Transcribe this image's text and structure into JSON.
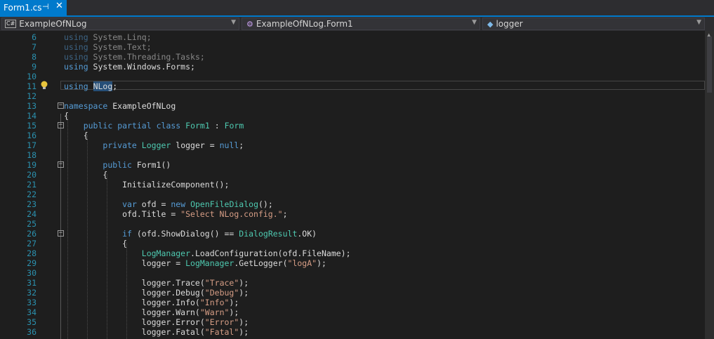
{
  "tab": {
    "title": "Form1.cs",
    "pin": "⊣",
    "close": "✕"
  },
  "nav": {
    "project": "ExampleOfNLog",
    "type": "ExampleOfNLog.Form1",
    "member": "logger",
    "project_icon": "csharp-file-icon",
    "type_icon": "class-icon",
    "member_icon": "field-icon"
  },
  "colors": {
    "accent": "#007acc",
    "keyword": "#569cd6",
    "type": "#4ec9b0",
    "string": "#d69d85",
    "line_number": "#2b91af"
  },
  "code_lines": [
    {
      "n": "6",
      "tokens": [
        [
          "kw dim",
          "using"
        ],
        [
          "dim",
          " System.Linq;"
        ]
      ]
    },
    {
      "n": "7",
      "tokens": [
        [
          "kw dim",
          "using"
        ],
        [
          "dim",
          " System.Text;"
        ]
      ]
    },
    {
      "n": "8",
      "tokens": [
        [
          "kw dim",
          "using"
        ],
        [
          "dim",
          " System.Threading.Tasks;"
        ]
      ]
    },
    {
      "n": "9",
      "tokens": [
        [
          "kw",
          "using"
        ],
        [
          "",
          " System.Windows.Forms;"
        ]
      ]
    },
    {
      "n": "10",
      "tokens": []
    },
    {
      "n": "11",
      "tokens": [
        [
          "kw",
          "using"
        ],
        [
          "",
          " "
        ],
        [
          "sel",
          "NLog"
        ],
        [
          "",
          ";"
        ]
      ]
    },
    {
      "n": "12",
      "tokens": []
    },
    {
      "n": "13",
      "tokens": [
        [
          "kw",
          "namespace"
        ],
        [
          "",
          " ExampleOfNLog"
        ]
      ]
    },
    {
      "n": "14",
      "tokens": [
        [
          "",
          "{"
        ]
      ]
    },
    {
      "n": "15",
      "tokens": [
        [
          "",
          "    "
        ],
        [
          "kw",
          "public"
        ],
        [
          "",
          " "
        ],
        [
          "kw",
          "partial"
        ],
        [
          "",
          " "
        ],
        [
          "kw",
          "class"
        ],
        [
          "",
          " "
        ],
        [
          "ty",
          "Form1"
        ],
        [
          "",
          " : "
        ],
        [
          "ty",
          "Form"
        ]
      ]
    },
    {
      "n": "16",
      "tokens": [
        [
          "",
          "    {"
        ]
      ]
    },
    {
      "n": "17",
      "tokens": [
        [
          "",
          "        "
        ],
        [
          "kw",
          "private"
        ],
        [
          "",
          " "
        ],
        [
          "ty",
          "Logger"
        ],
        [
          "",
          " logger = "
        ],
        [
          "kw",
          "null"
        ],
        [
          "",
          ";"
        ]
      ]
    },
    {
      "n": "18",
      "tokens": []
    },
    {
      "n": "19",
      "tokens": [
        [
          "",
          "        "
        ],
        [
          "kw",
          "public"
        ],
        [
          "",
          " Form1()"
        ]
      ]
    },
    {
      "n": "20",
      "tokens": [
        [
          "",
          "        {"
        ]
      ]
    },
    {
      "n": "21",
      "tokens": [
        [
          "",
          "            InitializeComponent();"
        ]
      ]
    },
    {
      "n": "22",
      "tokens": []
    },
    {
      "n": "23",
      "tokens": [
        [
          "",
          "            "
        ],
        [
          "kw",
          "var"
        ],
        [
          "",
          " ofd = "
        ],
        [
          "kw",
          "new"
        ],
        [
          "",
          " "
        ],
        [
          "ty",
          "OpenFileDialog"
        ],
        [
          "",
          "();"
        ]
      ]
    },
    {
      "n": "24",
      "tokens": [
        [
          "",
          "            ofd.Title = "
        ],
        [
          "str",
          "\"Select NLog.config.\""
        ],
        [
          "",
          ";"
        ]
      ]
    },
    {
      "n": "25",
      "tokens": []
    },
    {
      "n": "26",
      "tokens": [
        [
          "",
          "            "
        ],
        [
          "kw",
          "if"
        ],
        [
          "",
          " (ofd.ShowDialog() == "
        ],
        [
          "ty",
          "DialogResult"
        ],
        [
          "",
          ".OK)"
        ]
      ]
    },
    {
      "n": "27",
      "tokens": [
        [
          "",
          "            {"
        ]
      ]
    },
    {
      "n": "28",
      "tokens": [
        [
          "",
          "                "
        ],
        [
          "ty",
          "LogManager"
        ],
        [
          "",
          ".LoadConfiguration(ofd.FileName);"
        ]
      ]
    },
    {
      "n": "29",
      "tokens": [
        [
          "",
          "                logger = "
        ],
        [
          "ty",
          "LogManager"
        ],
        [
          "",
          ".GetLogger("
        ],
        [
          "str",
          "\"logA\""
        ],
        [
          "",
          ");"
        ]
      ]
    },
    {
      "n": "30",
      "tokens": []
    },
    {
      "n": "31",
      "tokens": [
        [
          "",
          "                logger.Trace("
        ],
        [
          "str",
          "\"Trace\""
        ],
        [
          "",
          ");"
        ]
      ]
    },
    {
      "n": "32",
      "tokens": [
        [
          "",
          "                logger.Debug("
        ],
        [
          "str",
          "\"Debug\""
        ],
        [
          "",
          ");"
        ]
      ]
    },
    {
      "n": "33",
      "tokens": [
        [
          "",
          "                logger.Info("
        ],
        [
          "str",
          "\"Info\""
        ],
        [
          "",
          ");"
        ]
      ]
    },
    {
      "n": "34",
      "tokens": [
        [
          "",
          "                logger.Warn("
        ],
        [
          "str",
          "\"Warn\""
        ],
        [
          "",
          ");"
        ]
      ]
    },
    {
      "n": "35",
      "tokens": [
        [
          "",
          "                logger.Error("
        ],
        [
          "str",
          "\"Error\""
        ],
        [
          "",
          ");"
        ]
      ]
    },
    {
      "n": "36",
      "tokens": [
        [
          "",
          "                logger.Fatal("
        ],
        [
          "str",
          "\"Fatal\""
        ],
        [
          "",
          ");"
        ]
      ]
    }
  ],
  "fold_markers": [
    "13",
    "15",
    "19",
    "26"
  ]
}
